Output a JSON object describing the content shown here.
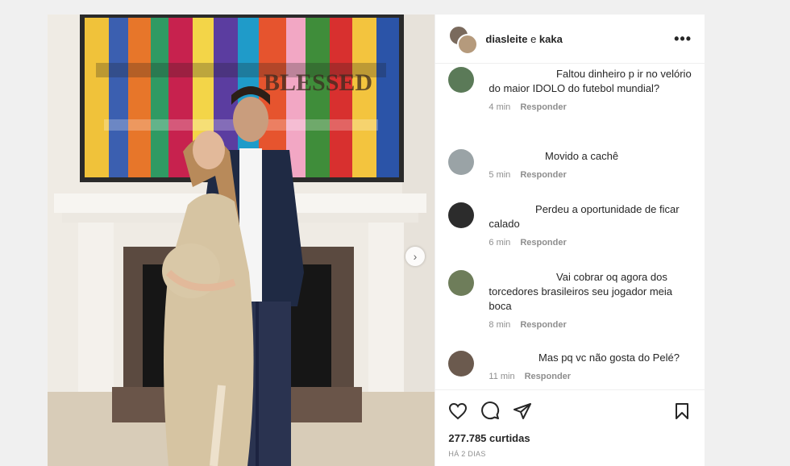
{
  "post": {
    "authors": {
      "first": "diasleite",
      "conj": "e",
      "second": "kaka"
    },
    "more_icon": "more-horizontal-icon",
    "next_icon": "chevron-right-icon",
    "painting_text": "BLESSED"
  },
  "comments": [
    {
      "text": "Faltou dinheiro p ir no velório do maior IDOLO do futebol mundial?",
      "time": "4 min",
      "reply": "Responder",
      "avatar_color": "#5b7a58"
    },
    {
      "text": "Movido a cachê",
      "time": "5 min",
      "reply": "Responder",
      "avatar_color": "#9aa3a6"
    },
    {
      "text": "Perdeu a oportunidade de ficar calado",
      "time": "6 min",
      "reply": "Responder",
      "avatar_color": "#2c2c2c"
    },
    {
      "text": "Vai cobrar oq agora dos torcedores brasileiros seu jogador meia boca",
      "time": "8 min",
      "reply": "Responder",
      "avatar_color": "#6e7d5a"
    },
    {
      "text": "Mas pq vc não gosta do Pelé?",
      "time": "11 min",
      "reply": "Responder",
      "avatar_color": "#6b5a4e"
    }
  ],
  "actions": {
    "like_icon": "heart-icon",
    "comment_icon": "comment-icon",
    "share_icon": "share-icon",
    "save_icon": "bookmark-icon"
  },
  "likes_text": "277.785 curtidas",
  "posted_text": "HÁ 2 DIAS"
}
